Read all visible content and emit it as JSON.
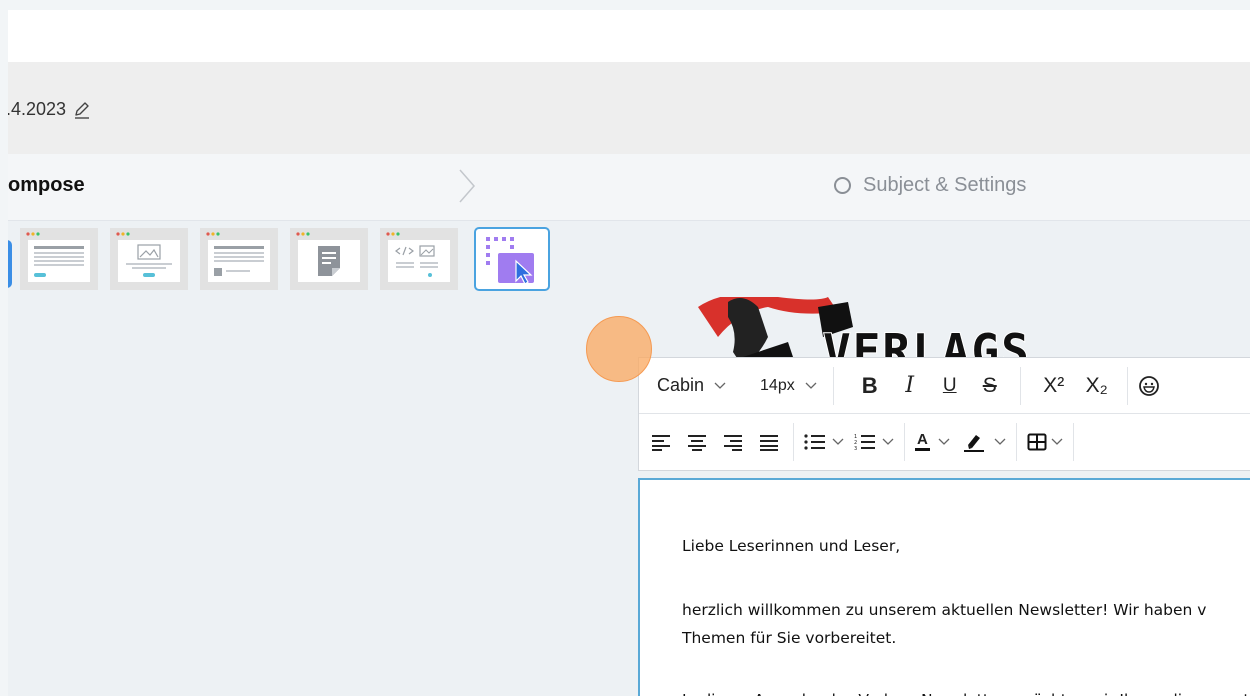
{
  "header": {
    "date_text": ".4.2023"
  },
  "steps": {
    "current": "ompose",
    "next": "Subject & Settings"
  },
  "blocks": [
    {
      "name": "text-with-button"
    },
    {
      "name": "image-with-button"
    },
    {
      "name": "text-and-image"
    },
    {
      "name": "note"
    },
    {
      "name": "html-code"
    },
    {
      "name": "custom-block",
      "selected": true
    }
  ],
  "logo": {
    "text": "VERLAGS-"
  },
  "toolbar": {
    "font_family": "Cabin",
    "font_size": "14px",
    "bold": "B",
    "italic": "I",
    "underline": "U",
    "strikethrough": "S",
    "superscript": "X²",
    "subscript": "X₂",
    "text_color_label": "A"
  },
  "editor": {
    "greeting": "Liebe Leserinnen und Leser,",
    "line1": "herzlich willkommen zu unserem aktuellen Newsletter! Wir haben v",
    "line2": "Themen für Sie vorbereitet.",
    "line3_partial": "In dieser Ausgabe des Verlags-Newsletters möchten wir Ihnen die neuesten Entwicklungen"
  },
  "colors": {
    "accent": "#4aa3e0",
    "cursor": "#f59a52",
    "block_icon": "#a07cf0"
  }
}
